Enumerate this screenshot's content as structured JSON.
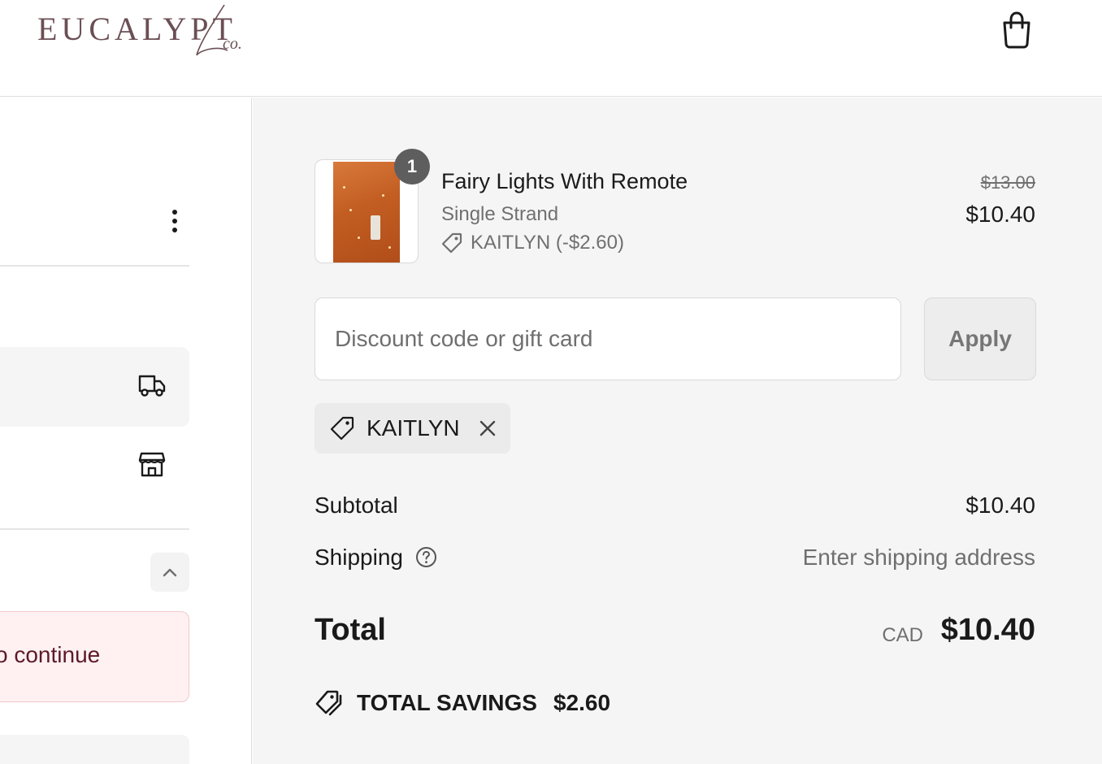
{
  "header": {
    "logo_text": "EUCALYPT",
    "logo_script": "co."
  },
  "icons": {
    "cart": "shopping-bag-icon",
    "more": "kebab-menu-icon",
    "ship": "truck-icon",
    "pickup": "store-icon",
    "collapse": "chevron-up-icon",
    "tag": "tag-icon",
    "remove": "close-icon",
    "help": "question-circle-icon",
    "savings": "tags-icon"
  },
  "left": {
    "error_text": "o continue"
  },
  "order": {
    "item": {
      "quantity": "1",
      "name": "Fairy Lights With Remote",
      "variant": "Single Strand",
      "discount_line": "KAITLYN (-$2.60)",
      "original_price": "$13.00",
      "price": "$10.40"
    },
    "discount": {
      "placeholder": "Discount code or gift card",
      "value": "",
      "apply_label": "Apply",
      "applied_code": "KAITLYN"
    },
    "summary": {
      "subtotal_label": "Subtotal",
      "subtotal_value": "$10.40",
      "shipping_label": "Shipping",
      "shipping_value": "Enter shipping address",
      "total_label": "Total",
      "currency": "CAD",
      "total_value": "$10.40",
      "savings_label": "TOTAL SAVINGS",
      "savings_value": "$2.60"
    }
  },
  "colors": {
    "brand": "#6b4f55",
    "summary_bg": "#f5f5f5",
    "error_bg": "#fff1f2",
    "error_text": "#5c1a26",
    "badge": "#5e5e5e"
  }
}
